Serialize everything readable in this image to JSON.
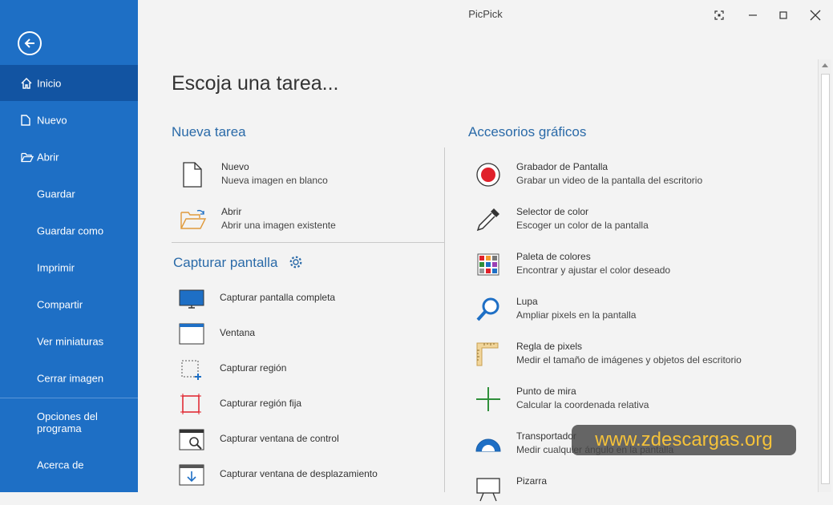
{
  "window": {
    "title": "PicPick"
  },
  "sidebar": {
    "items": [
      {
        "label": "Inicio"
      },
      {
        "label": "Nuevo"
      },
      {
        "label": "Abrir"
      },
      {
        "label": "Guardar"
      },
      {
        "label": "Guardar como"
      },
      {
        "label": "Imprimir"
      },
      {
        "label": "Compartir"
      },
      {
        "label": "Ver miniaturas"
      },
      {
        "label": "Cerrar imagen"
      },
      {
        "label": "Opciones del programa"
      },
      {
        "label": "Acerca de"
      }
    ]
  },
  "main": {
    "page_title": "Escoja una tarea...",
    "new_task": {
      "heading": "Nueva tarea",
      "items": [
        {
          "title": "Nuevo",
          "subtitle": "Nueva imagen en blanco"
        },
        {
          "title": "Abrir",
          "subtitle": "Abrir una imagen existente"
        }
      ]
    },
    "capture": {
      "heading": "Capturar pantalla",
      "items": [
        {
          "label": "Capturar pantalla completa"
        },
        {
          "label": "Ventana"
        },
        {
          "label": "Capturar región"
        },
        {
          "label": "Capturar región fija"
        },
        {
          "label": "Capturar ventana de control"
        },
        {
          "label": "Capturar ventana de desplazamiento"
        }
      ]
    },
    "accessories": {
      "heading": "Accesorios gráficos",
      "items": [
        {
          "title": "Grabador de Pantalla",
          "subtitle": "Grabar un video de la pantalla del escritorio"
        },
        {
          "title": "Selector de color",
          "subtitle": "Escoger un color de la pantalla"
        },
        {
          "title": "Paleta de colores",
          "subtitle": "Encontrar y ajustar el color deseado"
        },
        {
          "title": "Lupa",
          "subtitle": "Ampliar pixels en la pantalla"
        },
        {
          "title": "Regla de pixels",
          "subtitle": "Medir el tamaño de imágenes y objetos del escritorio"
        },
        {
          "title": "Punto de mira",
          "subtitle": "Calcular la coordenada relativa"
        },
        {
          "title": "Transportador",
          "subtitle": "Medir cualquier ángulo en la pantalla"
        },
        {
          "title": "Pizarra",
          "subtitle": ""
        }
      ]
    }
  },
  "watermark": "www.zdescargas.org",
  "colors": {
    "sidebar": "#1e6fc5",
    "sidebar_active": "#1254a2",
    "heading": "#2a6aa8",
    "record_red": "#e0202a",
    "watermark_text": "#f5c23a"
  }
}
